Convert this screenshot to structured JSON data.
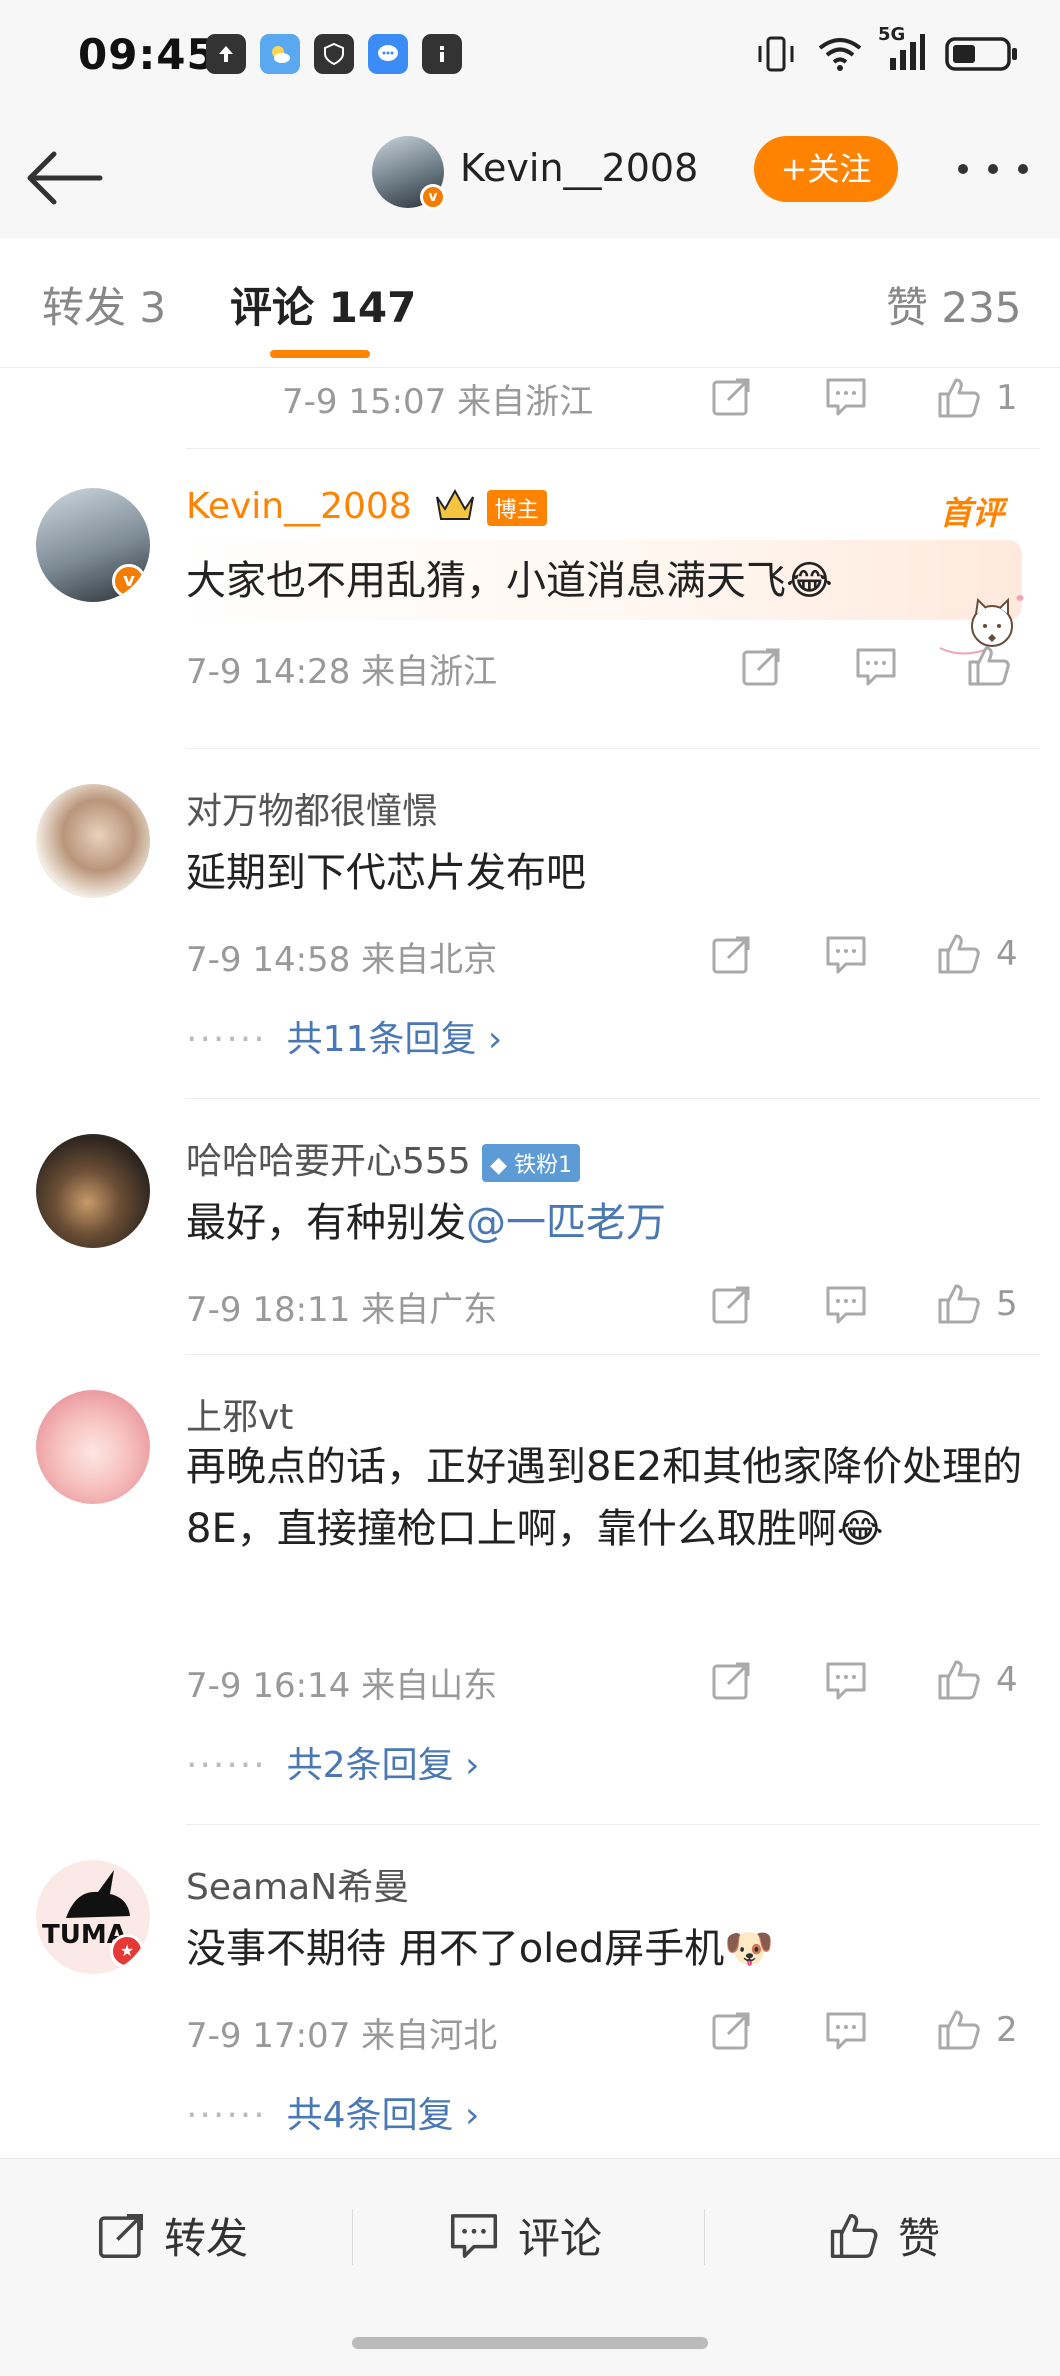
{
  "status_bar": {
    "time": "09:45",
    "network": "5G"
  },
  "header": {
    "username": "Kevin__2008",
    "follow_label": "+关注"
  },
  "tabs": {
    "repost": "转发 3",
    "comments": "评论 147",
    "likes": "赞 235"
  },
  "partial_row": {
    "meta": "7-9 15:07  来自浙江",
    "likes": "1"
  },
  "comments": [
    {
      "name": "Kevin__2008",
      "badge": "博主",
      "first_tag": "首评",
      "text": "大家也不用乱猜，小道消息满天飞😂",
      "meta": "7-9 14:28  来自浙江",
      "likes": ""
    },
    {
      "name": "对万物都很憧憬",
      "text": "延期到下代芯片发布吧",
      "meta": "7-9 14:58  来自北京",
      "likes": "4",
      "replies": "共11条回复 ›"
    },
    {
      "name": "哈哈哈要开心555",
      "badge": "铁粉1",
      "text_before": "最好，有种别发",
      "mention": "@一匹老万",
      "meta": "7-9 18:11  来自广东",
      "likes": "5"
    },
    {
      "name": "上邪vt",
      "text": "再晚点的话，正好遇到8E2和其他家降价处理的8E，直接撞枪口上啊，靠什么取胜啊😂",
      "meta": "7-9 16:14  来自山东",
      "likes": "4",
      "replies": "共2条回复 ›"
    },
    {
      "name": "SeamaN希曼",
      "text": "没事不期待 用不了oled屏手机🐶",
      "meta": "7-9 17:07  来自河北",
      "likes": "2",
      "replies": "共4条回复 ›",
      "avatar_text": "TUMA"
    }
  ],
  "bottom_bar": {
    "repost": "转发",
    "comment": "评论",
    "like": "赞"
  },
  "colors": {
    "accent": "#ff8200",
    "link": "#4a78b5"
  }
}
